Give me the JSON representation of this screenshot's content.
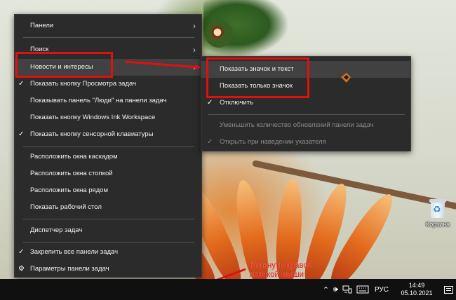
{
  "taskbar_menu": {
    "items": [
      {
        "label": "Панели",
        "checked": false,
        "has_submenu": true
      },
      {
        "label": "Поиск",
        "checked": false,
        "has_submenu": true
      },
      {
        "label": "Новости и интересы",
        "checked": false,
        "has_submenu": true,
        "highlighted": true
      },
      {
        "label": "Показать кнопку Просмотра задач",
        "checked": true,
        "has_submenu": false
      },
      {
        "label": "Показывать панель \"Люди\" на панели задач",
        "checked": false,
        "has_submenu": false
      },
      {
        "label": "Показать кнопку Windows Ink Workspace",
        "checked": false,
        "has_submenu": false
      },
      {
        "label": "Показать кнопку сенсорной клавиатуры",
        "checked": true,
        "has_submenu": false
      },
      {
        "label": "Расположить окна каскадом",
        "checked": false,
        "has_submenu": false
      },
      {
        "label": "Расположить окна стопкой",
        "checked": false,
        "has_submenu": false
      },
      {
        "label": "Расположить окна рядом",
        "checked": false,
        "has_submenu": false
      },
      {
        "label": "Показать рабочий стол",
        "checked": false,
        "has_submenu": false
      },
      {
        "label": "Диспетчер задач",
        "checked": false,
        "has_submenu": false
      },
      {
        "label": "Закрепить все панели задач",
        "checked": true,
        "has_submenu": false
      },
      {
        "label": "Параметры панели задач",
        "icon": "gear-icon"
      }
    ]
  },
  "news_submenu": {
    "items": [
      {
        "label": "Показать значок и текст",
        "highlighted": true
      },
      {
        "label": "Показать только значок"
      },
      {
        "label": "Отключить",
        "checked": true
      },
      {
        "label": "Уменьшить количество обновлений панели задач",
        "disabled": true
      },
      {
        "label": "Открыть при наведении указателя",
        "checked": true,
        "disabled": true
      }
    ]
  },
  "desktop": {
    "recycle_bin_label": "Корзина"
  },
  "annotation": {
    "line1": "Кликнуть правой",
    "line2": "кнопкой мыши",
    "color": "#e01010"
  },
  "tray": {
    "language": "РУС",
    "time": "14:49",
    "date": "05.10.2021"
  }
}
